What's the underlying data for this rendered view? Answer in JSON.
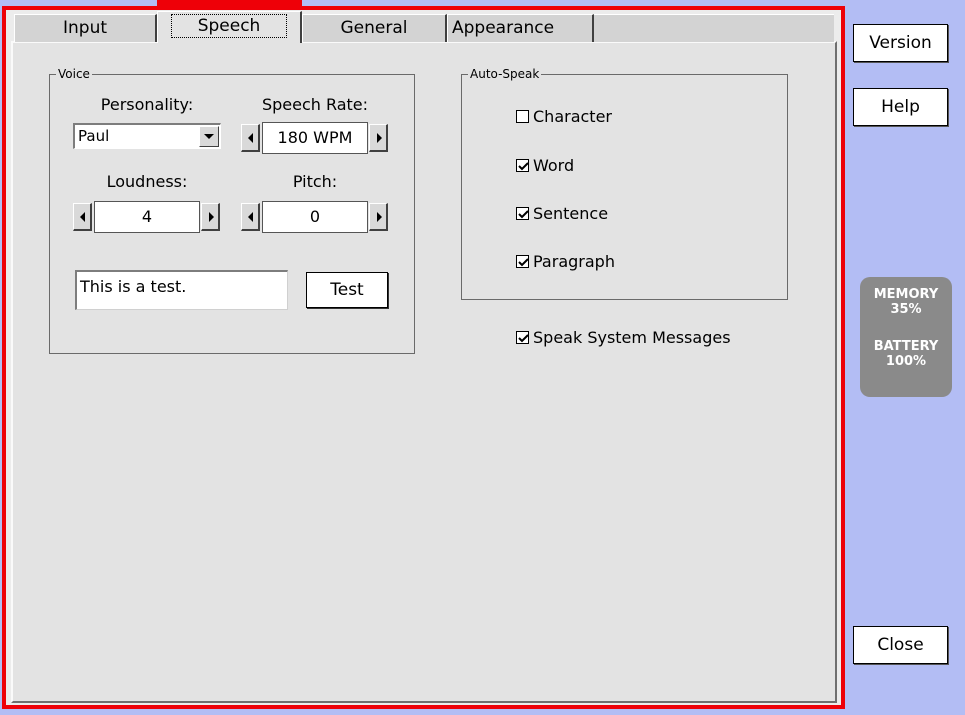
{
  "tabs": [
    {
      "label": "Input",
      "active": false
    },
    {
      "label": "Speech",
      "active": true
    },
    {
      "label": "General",
      "active": false
    },
    {
      "label": "Appearance",
      "active": false
    }
  ],
  "voice": {
    "legend": "Voice",
    "personality_label": "Personality:",
    "personality_value": "Paul",
    "speech_rate_label": "Speech Rate:",
    "speech_rate_value": "180 WPM",
    "loudness_label": "Loudness:",
    "loudness_value": "4",
    "pitch_label": "Pitch:",
    "pitch_value": "0",
    "test_text": "This is a test.",
    "test_button": "Test"
  },
  "auto_speak": {
    "legend": "Auto-Speak",
    "options": [
      {
        "label": "Character",
        "checked": false
      },
      {
        "label": "Word",
        "checked": true
      },
      {
        "label": "Sentence",
        "checked": true
      },
      {
        "label": "Paragraph",
        "checked": true
      }
    ]
  },
  "speak_system_messages": {
    "label": "Speak System Messages",
    "checked": true
  },
  "side_buttons": {
    "version": "Version",
    "help": "Help",
    "close": "Close"
  },
  "status": {
    "memory_label": "MEMORY",
    "memory_value": "35%",
    "battery_label": "BATTERY",
    "battery_value": "100%"
  },
  "colors": {
    "background": "#b3bdf4",
    "frame_accent": "#ee0008",
    "panel": "#e3e3e3",
    "status_card": "#8a8a8a"
  },
  "icons": [
    "combo-arrow-down-icon",
    "spin-left-arrow-icon",
    "spin-right-arrow-icon",
    "checkmark-icon"
  ]
}
